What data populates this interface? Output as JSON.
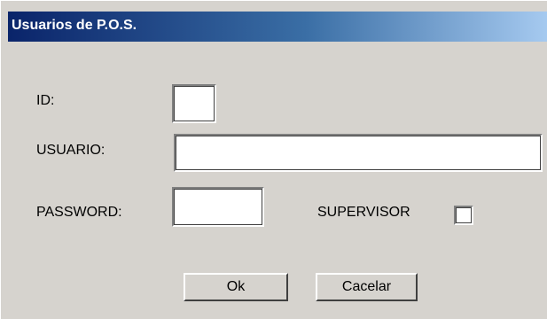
{
  "window": {
    "title": "Usuarios de P.O.S."
  },
  "form": {
    "id_label": "ID:",
    "id_value": "",
    "usuario_label": "USUARIO:",
    "usuario_value": "",
    "password_label": "PASSWORD:",
    "password_value": "",
    "supervisor_label": "SUPERVISOR",
    "supervisor_checked": false
  },
  "buttons": {
    "ok_label": "Ok",
    "cancel_label": "Cacelar"
  },
  "colors": {
    "title_gradient_start": "#0a246a",
    "title_gradient_end": "#a6caf0",
    "window_background": "#d6d3ce"
  }
}
